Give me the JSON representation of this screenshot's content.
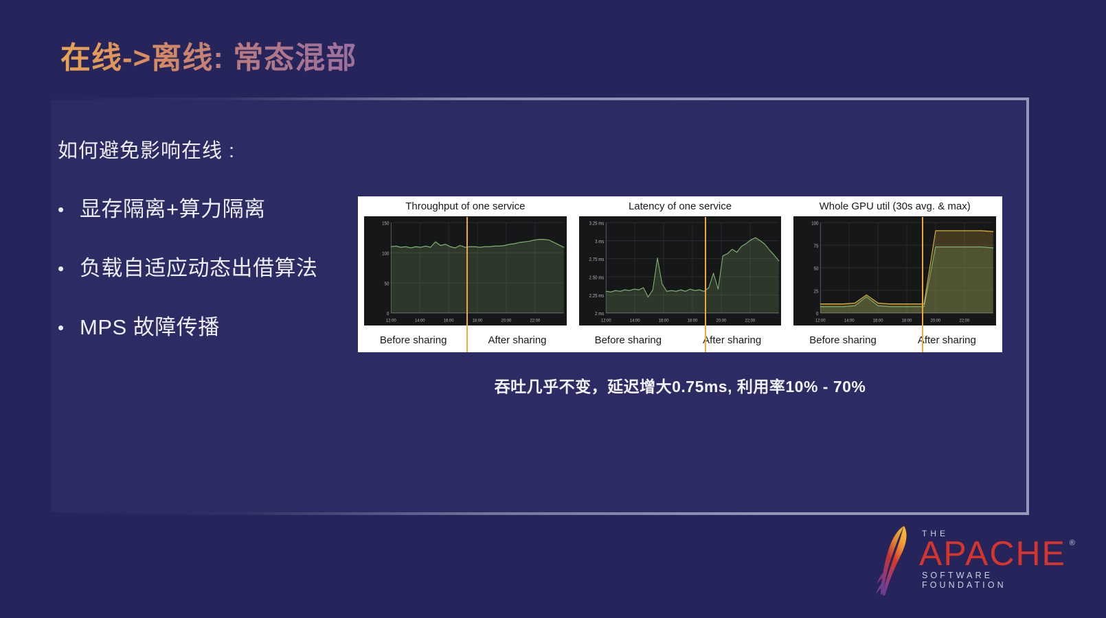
{
  "slide": {
    "title": "在线->离线: 常态混部",
    "background_color": "#26255b",
    "panel_color": "#2c2b64",
    "frame_color": "#9698ba",
    "title_gradient_from": "#e8a552",
    "title_gradient_to": "#9b6f9e"
  },
  "left_column": {
    "intro": "如何避免影响在线 :",
    "bullets": [
      {
        "marker": "•",
        "text": "显存隔离+算力隔离"
      },
      {
        "marker": "•",
        "text": "负载自适应动态出借算法"
      },
      {
        "marker": "•",
        "text": "MPS 故障传播"
      }
    ]
  },
  "figure": {
    "caption": "吞吐几乎不变，延迟增大0.75ms, 利用率10% - 70%",
    "before_label": "Before sharing",
    "after_label": "After sharing",
    "split_color": "#f2a93b"
  },
  "chart_data": [
    {
      "type": "line",
      "title": "Throughput of one service",
      "xlabel": "",
      "ylabel": "",
      "ylim": [
        0,
        150
      ],
      "yticks": [
        0,
        50,
        100,
        150
      ],
      "ytick_labels": [
        "0",
        "50",
        "100",
        "150"
      ],
      "xticks": [
        "12:00",
        "14:00",
        "16:00",
        "18:00",
        "20:00",
        "22:00"
      ],
      "grid": true,
      "annotation": "Before sharing / After sharing split at 19:15",
      "split_x": "19:15",
      "series": [
        {
          "name": "throughput",
          "color": "#7eb26d",
          "x": [
            "12:00",
            "12:20",
            "12:40",
            "13:00",
            "13:20",
            "13:40",
            "14:00",
            "14:20",
            "14:40",
            "15:00",
            "15:10",
            "15:20",
            "15:40",
            "16:00",
            "16:20",
            "16:40",
            "17:00",
            "17:20",
            "17:40",
            "18:00",
            "18:20",
            "18:40",
            "19:00",
            "19:15",
            "19:40",
            "20:00",
            "20:20",
            "20:40",
            "21:00",
            "21:20",
            "21:40",
            "22:00",
            "22:20",
            "22:40",
            "23:00",
            "23:20"
          ],
          "values": [
            110,
            111,
            109,
            110,
            108,
            110,
            109,
            111,
            109,
            118,
            112,
            114,
            110,
            108,
            112,
            109,
            110,
            110,
            109,
            110,
            110,
            111,
            111,
            112,
            114,
            115,
            117,
            118,
            119,
            121,
            122,
            122,
            121,
            117,
            113,
            109
          ]
        }
      ]
    },
    {
      "type": "line",
      "title": "Latency of one service",
      "xlabel": "",
      "ylabel": "",
      "ylim": [
        2,
        3.25
      ],
      "yticks": [
        2,
        2.25,
        2.5,
        2.75,
        3,
        3.25
      ],
      "ytick_labels": [
        "2 ms",
        "2.25 ms",
        "2.50 ms",
        "2.75 ms",
        "3 ms",
        "3.25 ms"
      ],
      "xticks": [
        "12:00",
        "14:00",
        "16:00",
        "18:00",
        "20:00",
        "22:00"
      ],
      "grid": true,
      "split_x": "19:15",
      "series": [
        {
          "name": "latency_ms",
          "color": "#7eb26d",
          "x": [
            "12:00",
            "12:20",
            "12:40",
            "13:00",
            "13:20",
            "13:40",
            "14:00",
            "14:20",
            "14:40",
            "15:00",
            "15:20",
            "15:30",
            "15:35",
            "15:40",
            "16:00",
            "16:20",
            "16:40",
            "17:00",
            "17:20",
            "17:40",
            "18:00",
            "18:20",
            "18:40",
            "19:00",
            "19:10",
            "19:15",
            "19:30",
            "20:00",
            "20:20",
            "20:40",
            "21:00",
            "21:20",
            "21:40",
            "22:00",
            "22:20",
            "22:40",
            "23:00",
            "23:20"
          ],
          "values": [
            2.3,
            2.29,
            2.31,
            2.3,
            2.32,
            2.31,
            2.33,
            2.32,
            2.35,
            2.22,
            2.32,
            2.76,
            2.4,
            2.3,
            2.31,
            2.3,
            2.32,
            2.3,
            2.33,
            2.31,
            2.32,
            2.3,
            2.35,
            2.55,
            2.33,
            2.79,
            2.82,
            2.88,
            2.84,
            2.92,
            2.96,
            3.01,
            3.04,
            3.0,
            2.95,
            2.87,
            2.8,
            2.72
          ]
        }
      ]
    },
    {
      "type": "line",
      "title": "Whole GPU util (30s avg. & max)",
      "xlabel": "",
      "ylabel": "",
      "ylim": [
        0,
        100
      ],
      "yticks": [
        0,
        25,
        50,
        75,
        100
      ],
      "ytick_labels": [
        "0",
        "25",
        "50",
        "75",
        "100"
      ],
      "xticks": [
        "12:00",
        "14:00",
        "16:00",
        "18:00",
        "20:00",
        "22:00"
      ],
      "grid": true,
      "split_x": "19:15",
      "series": [
        {
          "name": "max",
          "color": "#e0b83a",
          "x": [
            "12:00",
            "13:00",
            "14:00",
            "15:00",
            "15:30",
            "15:40",
            "16:00",
            "17:00",
            "18:00",
            "19:00",
            "19:15",
            "20:00",
            "21:00",
            "22:00",
            "23:00",
            "23:30"
          ],
          "values": [
            10,
            10,
            10,
            11,
            20,
            11,
            10,
            10,
            10,
            10,
            91,
            91,
            91,
            91,
            91,
            90
          ]
        },
        {
          "name": "avg",
          "color": "#7eb26d",
          "x": [
            "12:00",
            "13:00",
            "14:00",
            "15:00",
            "15:30",
            "15:40",
            "16:00",
            "17:00",
            "18:00",
            "19:00",
            "19:15",
            "20:00",
            "21:00",
            "22:00",
            "23:00",
            "23:30"
          ],
          "values": [
            7,
            7,
            7,
            8,
            18,
            8,
            7,
            7,
            7,
            7,
            73,
            73,
            73,
            73,
            73,
            72
          ]
        }
      ]
    }
  ],
  "footer": {
    "logo": {
      "the": "THE",
      "apache": "APACHE",
      "registered": "®",
      "foundation": "SOFTWARE FOUNDATION",
      "feather_gradient_from": "#f5a623",
      "feather_gradient_mid": "#d5352b",
      "feather_gradient_to": "#7b3f8f",
      "wordmark_color": "#d5352b"
    }
  }
}
